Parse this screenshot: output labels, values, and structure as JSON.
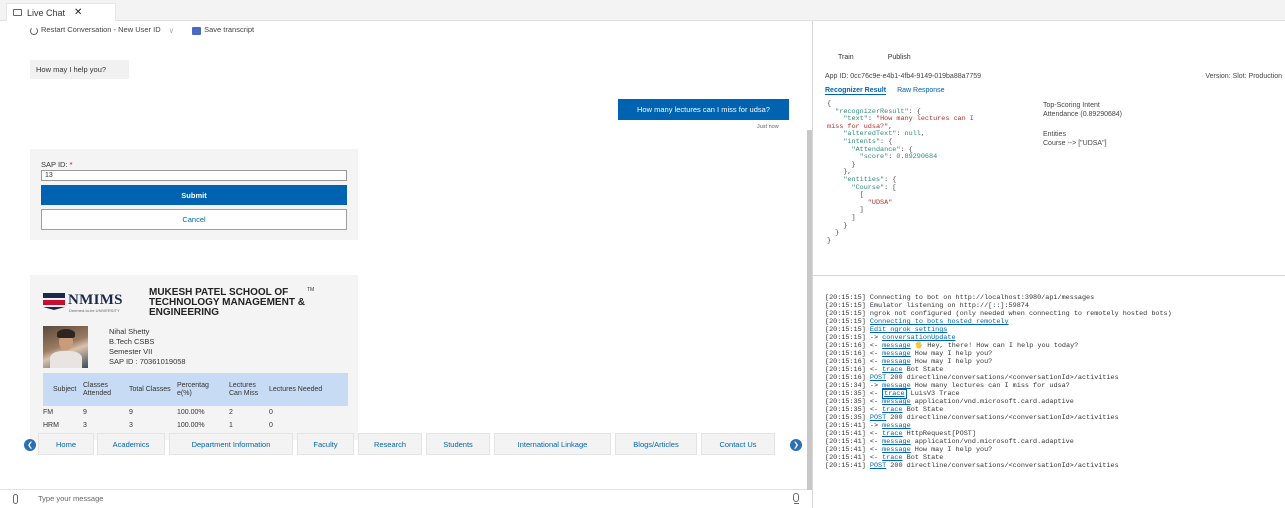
{
  "window": {
    "tab_label": "Live Chat",
    "tab_close": "✕"
  },
  "toolbar": {
    "restart_label": "Restart Conversation - New User ID",
    "restart_chevron": "∨",
    "save_transcript": "Save transcript"
  },
  "chat": {
    "bot_greeting": "How may I help you?",
    "user_message": "How many lectures can I miss for udsa?",
    "timestamp": "Just now",
    "form": {
      "label": "SAP ID:",
      "required_mark": "*",
      "input_value": "13",
      "submit_label": "Submit",
      "cancel_label": "Cancel"
    },
    "student_card": {
      "logo_text": "NMIMS",
      "logo_sub": "Deemed-to-be UNIVERSITY",
      "school_name": "MUKESH PATEL SCHOOL OF TECHNOLOGY MANAGEMENT & ENGINEERING",
      "trademark": "TM",
      "name": "Nihal Shetty",
      "program": "B.Tech CSBS",
      "semester": "Semester VII",
      "sap_id": "SAP ID : 70361019058",
      "table": {
        "headers": [
          "Subject",
          "Classes Attended",
          "Total Classes",
          "Percentag e(%)",
          "Lectures Can Miss",
          "Lectures Needed"
        ],
        "rows": [
          [
            "FM",
            "9",
            "9",
            "100.00%",
            "2",
            "0"
          ],
          [
            "HRM",
            "3",
            "3",
            "100.00%",
            "1",
            "0"
          ]
        ]
      }
    },
    "suggested_actions": [
      "Home",
      "Academics",
      "Department Information",
      "Faculty",
      "Research",
      "Students",
      "International Linkage",
      "Blogs/Articles",
      "Contact Us"
    ],
    "input_placeholder": "Type your message"
  },
  "inspector": {
    "tabs": [
      "Train",
      "Publish"
    ],
    "app_id": "App ID: 0cc76c9e-e4b1-4fb4-9149-019ba88a7759",
    "version": "Version:   Slot: Production",
    "result_tabs": [
      "Recognizer Result",
      "Raw Response"
    ],
    "json": {
      "l1": "{",
      "k_recognizer": "\"recognizerResult\"",
      "k_text": "\"text\"",
      "v_text_a": "\"How many lectures can I",
      "v_text_b": "miss for udsa?\"",
      "k_altered": "\"alteredText\"",
      "v_null": "null",
      "k_intents": "\"intents\"",
      "k_attendance": "\"Attendance\"",
      "k_score": "\"score\"",
      "v_score": "0.89290684",
      "k_entities": "\"entities\"",
      "k_course": "\"Course\"",
      "v_udsa": "\"UDSA\""
    },
    "summary": {
      "intent_title": "Top-Scoring Intent",
      "intent_value": "Attendance (0.89290684)",
      "entities_title": "Entities",
      "entities_value": "Course --> [\"UDSA\"]"
    }
  },
  "log": {
    "lines": [
      {
        "t": "[20:15:15]",
        "pre": " Connecting to bot on http://localhost:3980/api/messages",
        "link": "",
        "post": ""
      },
      {
        "t": "[20:15:15]",
        "pre": " Emulator listening on http://[::]:59874",
        "link": "",
        "post": ""
      },
      {
        "t": "[20:15:15]",
        "pre": " ngrok not configured (only needed when connecting to remotely hosted bots)",
        "link": "",
        "post": ""
      },
      {
        "t": "[20:15:15]",
        "pre": " ",
        "link": "Connecting to bots hosted remotely",
        "post": ""
      },
      {
        "t": "[20:15:15]",
        "pre": " ",
        "link": "Edit ngrok settings",
        "post": ""
      },
      {
        "t": "[20:15:15]",
        "pre": " -> ",
        "link": "conversationUpdate",
        "post": ""
      },
      {
        "t": "[20:15:16]",
        "pre": " <- ",
        "link": "message",
        "post": " 🖐 Hey, there! How can I help you today?"
      },
      {
        "t": "[20:15:16]",
        "pre": " <- ",
        "link": "message",
        "post": " How may I help you?"
      },
      {
        "t": "[20:15:16]",
        "pre": " <- ",
        "link": "message",
        "post": " How may I help you?"
      },
      {
        "t": "[20:15:16]",
        "pre": " <- ",
        "link": "trace",
        "post": " Bot State"
      },
      {
        "t": "[20:15:16]",
        "pre": " ",
        "link": "POST",
        "post": " 200 directline/conversations/<conversationId>/activities"
      },
      {
        "t": "[20:15:34]",
        "pre": " -> ",
        "link": "message",
        "post": " How many lectures can I miss for udsa?"
      },
      {
        "t": "[20:15:35]",
        "pre": " <- ",
        "link": "trace",
        "post": " LuisV3 Trace",
        "boxed": true
      },
      {
        "t": "[20:15:35]",
        "pre": " <- ",
        "link": "message",
        "post": " application/vnd.microsoft.card.adaptive"
      },
      {
        "t": "[20:15:35]",
        "pre": " <- ",
        "link": "trace",
        "post": " Bot State"
      },
      {
        "t": "[20:15:35]",
        "pre": " ",
        "link": "POST",
        "post": " 200 directline/conversations/<conversationId>/activities"
      },
      {
        "t": "[20:15:41]",
        "pre": " -> ",
        "link": "message",
        "post": ""
      },
      {
        "t": "[20:15:41]",
        "pre": " <- ",
        "link": "trace",
        "post": " HttpRequest[POST]"
      },
      {
        "t": "[20:15:41]",
        "pre": " <- ",
        "link": "message",
        "post": " application/vnd.microsoft.card.adaptive"
      },
      {
        "t": "[20:15:41]",
        "pre": " <- ",
        "link": "message",
        "post": " How may I help you?"
      },
      {
        "t": "[20:15:41]",
        "pre": " <- ",
        "link": "trace",
        "post": " Bot State"
      },
      {
        "t": "[20:15:41]",
        "pre": " ",
        "link": "POST",
        "post": " 200 directline/conversations/<conversationId>/activities"
      }
    ]
  },
  "colors": {
    "accent": "#0063b1",
    "table_header": "#c7dbf4",
    "card_bg": "#f4f4f4"
  }
}
